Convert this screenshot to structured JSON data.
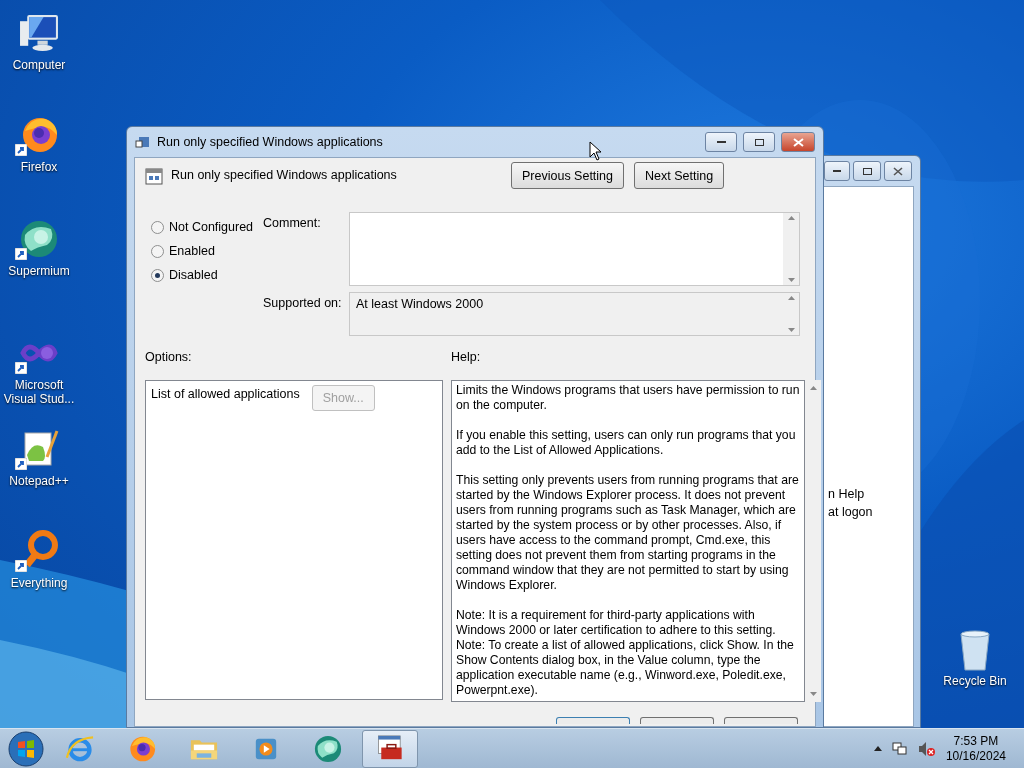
{
  "desktop_icons": [
    {
      "label": "Computer",
      "kind": "computer",
      "shortcut": false
    },
    {
      "label": "Firefox",
      "kind": "firefox",
      "shortcut": true
    },
    {
      "label": "Supermium",
      "kind": "supermium",
      "shortcut": true
    },
    {
      "label": "Microsoft Visual Stud...",
      "kind": "visual-studio",
      "shortcut": true
    },
    {
      "label": "Notepad++",
      "kind": "notepad",
      "shortcut": true
    },
    {
      "label": "Everything",
      "kind": "everything",
      "shortcut": true
    }
  ],
  "recycle_bin": {
    "label": "Recycle Bin"
  },
  "background_window": {
    "texts": [
      "n Help",
      "at logon"
    ]
  },
  "dialog": {
    "title": "Run only specified Windows applications",
    "header": "Run only specified Windows applications",
    "buttons": [
      "Previous Setting",
      "Next Setting"
    ],
    "radios": [
      {
        "label": "Not Configured",
        "selected": false
      },
      {
        "label": "Enabled",
        "selected": false
      },
      {
        "label": "Disabled",
        "selected": true
      }
    ],
    "comment_label": "Comment:",
    "supported_label": "Supported on:",
    "supported_value": "At least Windows 2000",
    "options_label": "Options:",
    "help_label": "Help:",
    "option": {
      "label": "List of allowed applications",
      "button": "Show...",
      "button_disabled": true
    },
    "help": [
      [
        "Limits the Windows programs that users have permission to run on the computer."
      ],
      [
        "If you enable this setting, users can only run programs that you add to the List of Allowed Applications."
      ],
      [
        "This setting only prevents users from running programs that are started by the Windows Explorer process. It does not prevent users from running programs such as Task Manager, which are started by the system process or by other processes. Also, if users have access to the command prompt, Cmd.exe, this setting does not prevent them from starting programs in the command window that they are not permitted to start by using Windows Explorer."
      ],
      [
        "Note: It is a requirement for third-party applications with Windows 2000 or later certification to adhere to this setting.",
        "Note: To create a list of allowed applications, click Show. In the Show Contents dialog box, in the Value column, type the application executable name (e.g., Winword.exe, Poledit.exe, Powerpnt.exe)."
      ]
    ]
  },
  "taskbar": {
    "apps": [
      {
        "kind": "ie",
        "active": false
      },
      {
        "kind": "firefox",
        "active": false
      },
      {
        "kind": "explorer",
        "active": false
      },
      {
        "kind": "media",
        "active": false
      },
      {
        "kind": "supermium",
        "active": false
      },
      {
        "kind": "toolbox",
        "active": true
      }
    ],
    "time": "7:53 PM",
    "date": "10/16/2024"
  }
}
